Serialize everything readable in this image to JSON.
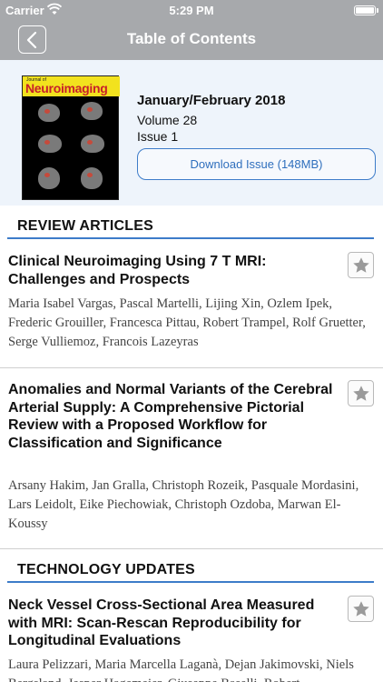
{
  "status_bar": {
    "carrier": "Carrier",
    "time": "5:29 PM"
  },
  "nav": {
    "title": "Table of Contents",
    "back_icon": "chevron-left-icon"
  },
  "issue": {
    "cover_journal_of": "Journal of",
    "cover_title": "Neuroimaging",
    "date": "January/February 2018",
    "volume": "Volume 28",
    "number": "Issue 1",
    "download_label": "Download Issue (148MB)"
  },
  "sections": [
    {
      "title": "REVIEW ARTICLES",
      "articles": [
        {
          "title": "Clinical Neuroimaging Using 7 T MRI: Challenges and Prospects",
          "authors": "Maria Isabel Vargas, Pascal Martelli, Lijing Xin, Ozlem Ipek, Frederic Grouiller, Francesca Pittau, Robert Trampel, Rolf Gruetter, Serge Vulliemoz, Francois Lazeyras"
        },
        {
          "title": "Anomalies and Normal Variants of the Cerebral Arterial Supply: A Comprehensive Pictorial Review with a Proposed Workflow for Classification and Significance",
          "authors": "Arsany Hakim, Jan Gralla, Christoph Rozeik, Pasquale Mordasini, Lars Leidolt, Eike Piechowiak, Christoph Ozdoba, Marwan El-Koussy"
        }
      ]
    },
    {
      "title": "TECHNOLOGY UPDATES",
      "articles": [
        {
          "title": "Neck Vessel Cross-Sectional Area Measured with MRI: Scan-Rescan Reproducibility for Longitudinal Evaluations",
          "authors": "Laura Pelizzari, Maria Marcella Laganà, Dejan Jakimovski, Niels Bergsland, Jesper Hagemeier, Giuseppe Baselli, Robert"
        }
      ]
    }
  ],
  "colors": {
    "nav_bar": "#a7a9ac",
    "accent": "#3d7cc9",
    "issue_background": "#eef4fb"
  }
}
